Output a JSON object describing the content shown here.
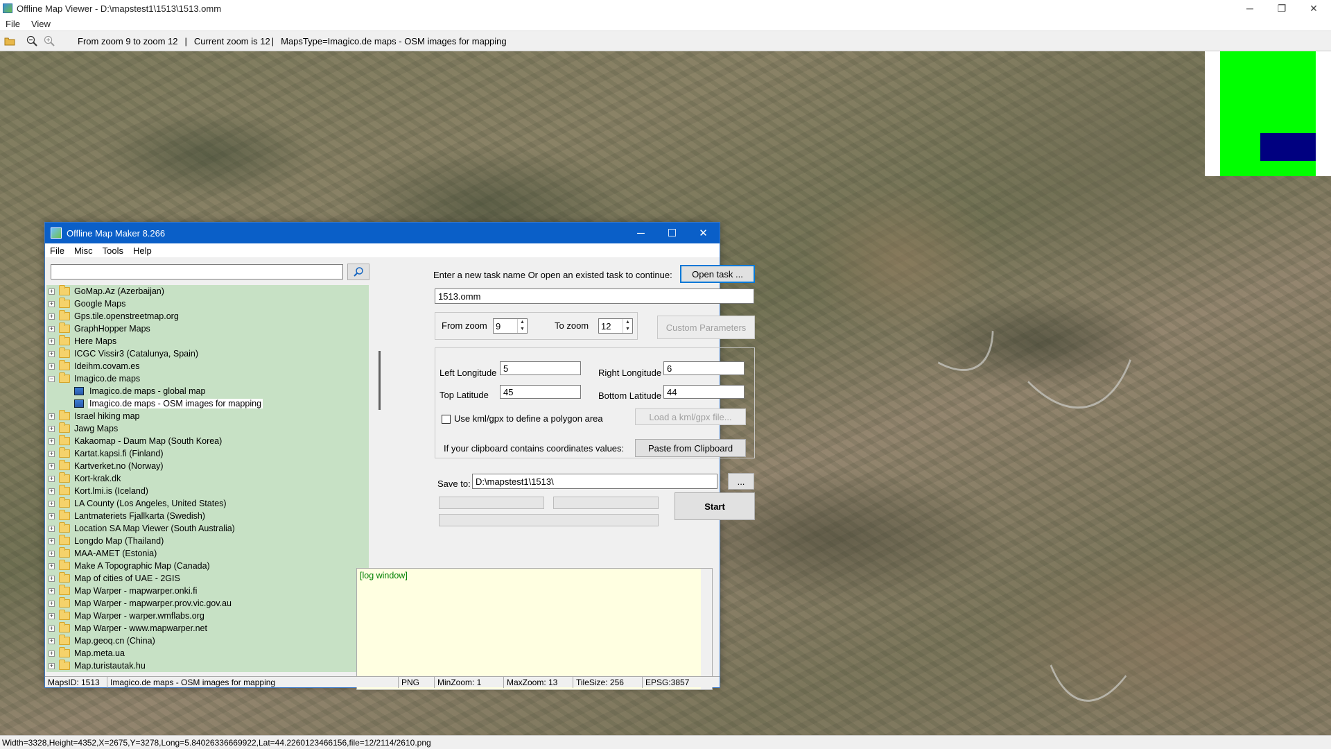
{
  "window": {
    "title": "Offline Map Viewer - D:\\mapstest1\\1513\\1513.omm",
    "controls": {
      "minimize": "─",
      "maximize": "❐",
      "close": "✕"
    }
  },
  "menu": {
    "file": "File",
    "view": "View"
  },
  "toolbar": {
    "zoom_range": "From zoom 9 to zoom 12",
    "current_zoom": "Current zoom is 12",
    "maps_type": "MapsType=Imagico.de maps - OSM images for mapping",
    "separator": "|"
  },
  "statusbar": {
    "text": "Width=3328,Height=4352,X=2675,Y=3278,Long=5.84026336669922,Lat=44.2260123466156,file=12/2114/2610.png"
  },
  "minimap": {
    "frame_color": "#00ff00",
    "viewport_color": "#000080"
  },
  "dialog": {
    "title": "Offline Map Maker 8.266",
    "controls": {
      "minimize": "─",
      "maximize": "☐",
      "close": "✕"
    },
    "menu": {
      "file": "File",
      "misc": "Misc",
      "tools": "Tools",
      "help": "Help"
    },
    "search": {
      "value": "",
      "placeholder": ""
    },
    "tree": {
      "folders_before": [
        "GoMap.Az (Azerbaijan)",
        "Google Maps",
        "Gps.tile.openstreetmap.org",
        "GraphHopper Maps",
        "Here Maps",
        "ICGC Vissir3 (Catalunya, Spain)",
        "Ideihm.covam.es"
      ],
      "expanded_folder": "Imagico.de maps",
      "children": [
        "Imagico.de maps - global map",
        "Imagico.de maps - OSM images for mapping"
      ],
      "selected_child_index": 1,
      "folders_after": [
        "Israel hiking map",
        "Jawg Maps",
        "Kakaomap - Daum Map (South Korea)",
        "Kartat.kapsi.fi (Finland)",
        "Kartverket.no (Norway)",
        "Kort-krak.dk",
        "Kort.lmi.is (Iceland)",
        "LA County (Los Angeles, United States)",
        "Lantmateriets Fjallkarta (Swedish)",
        "Location SA Map Viewer (South Australia)",
        "Longdo Map (Thailand)",
        "MAA-AMET (Estonia)",
        "Make A Topographic Map (Canada)",
        "Map of cities of UAE - 2GIS",
        "Map Warper - mapwarper.onki.fi",
        "Map Warper - mapwarper.prov.vic.gov.au",
        "Map Warper - warper.wmflabs.org",
        "Map Warper - www.mapwarper.net",
        "Map.geoq.cn (China)",
        "Map.meta.ua",
        "Map.turistautak.hu"
      ]
    },
    "form": {
      "task_prompt": "Enter a new task name Or open an existed task to continue:",
      "open_task": "Open task ...",
      "task_name": "1513.omm",
      "from_zoom_label": "From zoom",
      "from_zoom": "9",
      "to_zoom_label": "To zoom",
      "to_zoom": "12",
      "custom_params": "Custom Parameters",
      "left_lon_label": "Left Longitude",
      "left_lon": "5",
      "right_lon_label": "Right Longitude",
      "right_lon": "6",
      "top_lat_label": "Top Latitude",
      "top_lat": "45",
      "bottom_lat_label": "Bottom Latitude",
      "bottom_lat": "44",
      "kml_label": "Use kml/gpx to define a polygon area",
      "kml_checked": false,
      "load_kml": "Load a kml/gpx file...",
      "clipboard_label": "If your clipboard contains coordinates values:",
      "paste_clipboard": "Paste from Clipboard",
      "save_to_label": "Save to:",
      "save_to": "D:\\mapstest1\\1513\\",
      "browse": "...",
      "start": "Start",
      "log": "[log window]"
    },
    "status": {
      "maps_id": "MapsID: 1513",
      "name": "Imagico.de maps - OSM images for mapping",
      "format": "PNG",
      "min_zoom": "MinZoom: 1",
      "max_zoom": "MaxZoom: 13",
      "tile_size": "TileSize: 256",
      "epsg": "EPSG:3857"
    }
  }
}
